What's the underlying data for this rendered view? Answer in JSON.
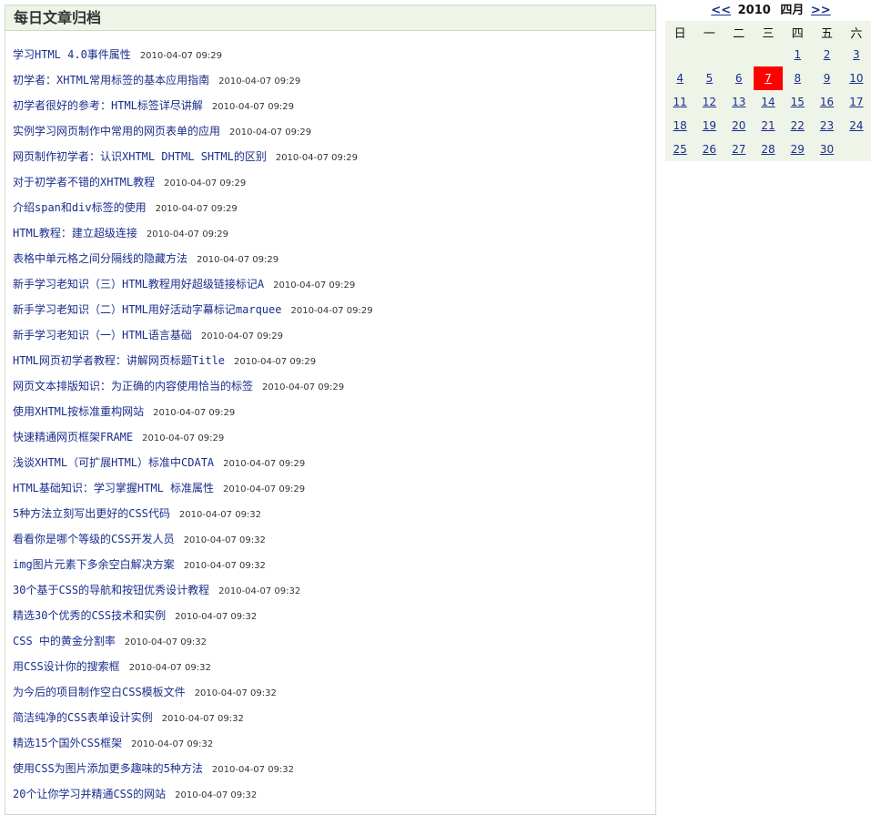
{
  "archive": {
    "header": "每日文章归档",
    "items": [
      {
        "title": "学习HTML 4.0事件属性",
        "time": "2010-04-07 09:29"
      },
      {
        "title": "初学者：XHTML常用标签的基本应用指南",
        "time": "2010-04-07 09:29"
      },
      {
        "title": "初学者很好的参考：HTML标签详尽讲解",
        "time": "2010-04-07 09:29"
      },
      {
        "title": "实例学习网页制作中常用的网页表单的应用",
        "time": "2010-04-07 09:29"
      },
      {
        "title": "网页制作初学者：认识XHTML DHTML SHTML的区别",
        "time": "2010-04-07 09:29"
      },
      {
        "title": "对于初学者不错的XHTML教程",
        "time": "2010-04-07 09:29"
      },
      {
        "title": "介绍span和div标签的使用",
        "time": "2010-04-07 09:29"
      },
      {
        "title": "HTML教程：建立超级连接",
        "time": "2010-04-07 09:29"
      },
      {
        "title": "表格中单元格之间分隔线的隐藏方法",
        "time": "2010-04-07 09:29"
      },
      {
        "title": "新手学习老知识（三）HTML教程用好超级链接标记A",
        "time": "2010-04-07 09:29"
      },
      {
        "title": "新手学习老知识（二）HTML用好活动字幕标记marquee",
        "time": "2010-04-07 09:29"
      },
      {
        "title": "新手学习老知识（一）HTML语言基础",
        "time": "2010-04-07 09:29"
      },
      {
        "title": "HTML网页初学者教程：讲解网页标题Title",
        "time": "2010-04-07 09:29"
      },
      {
        "title": "网页文本排版知识：为正确的内容使用恰当的标签",
        "time": "2010-04-07 09:29"
      },
      {
        "title": "使用XHTML按标准重构网站",
        "time": "2010-04-07 09:29"
      },
      {
        "title": "快速精通网页框架FRAME",
        "time": "2010-04-07 09:29"
      },
      {
        "title": "浅谈XHTML（可扩展HTML）标准中CDATA",
        "time": "2010-04-07 09:29"
      },
      {
        "title": "HTML基础知识：学习掌握HTML 标准属性",
        "time": "2010-04-07 09:29"
      },
      {
        "title": "5种方法立刻写出更好的CSS代码",
        "time": "2010-04-07 09:32"
      },
      {
        "title": "看看你是哪个等级的CSS开发人员",
        "time": "2010-04-07 09:32"
      },
      {
        "title": "img图片元素下多余空白解决方案",
        "time": "2010-04-07 09:32"
      },
      {
        "title": "30个基于CSS的导航和按钮优秀设计教程",
        "time": "2010-04-07 09:32"
      },
      {
        "title": "精选30个优秀的CSS技术和实例",
        "time": "2010-04-07 09:32"
      },
      {
        "title": "CSS 中的黄金分割率",
        "time": "2010-04-07 09:32"
      },
      {
        "title": "用CSS设计你的搜索框",
        "time": "2010-04-07 09:32"
      },
      {
        "title": "为今后的项目制作空白CSS模板文件",
        "time": "2010-04-07 09:32"
      },
      {
        "title": "简洁纯净的CSS表单设计实例",
        "time": "2010-04-07 09:32"
      },
      {
        "title": "精选15个国外CSS框架",
        "time": "2010-04-07 09:32"
      },
      {
        "title": "使用CSS为图片添加更多趣味的5种方法",
        "time": "2010-04-07 09:32"
      },
      {
        "title": "20个让你学习并精通CSS的网站",
        "time": "2010-04-07 09:32"
      }
    ]
  },
  "calendar": {
    "prev_label": "<<",
    "next_label": ">>",
    "year": "2010",
    "month": "四月",
    "weekdays": [
      "日",
      "一",
      "二",
      "三",
      "四",
      "五",
      "六"
    ],
    "today": "7",
    "weeks": [
      [
        "",
        "",
        "",
        "",
        "1",
        "2",
        "3"
      ],
      [
        "4",
        "5",
        "6",
        "7",
        "8",
        "9",
        "10"
      ],
      [
        "11",
        "12",
        "13",
        "14",
        "15",
        "16",
        "17"
      ],
      [
        "18",
        "19",
        "20",
        "21",
        "22",
        "23",
        "24"
      ],
      [
        "25",
        "26",
        "27",
        "28",
        "29",
        "30",
        ""
      ]
    ]
  }
}
